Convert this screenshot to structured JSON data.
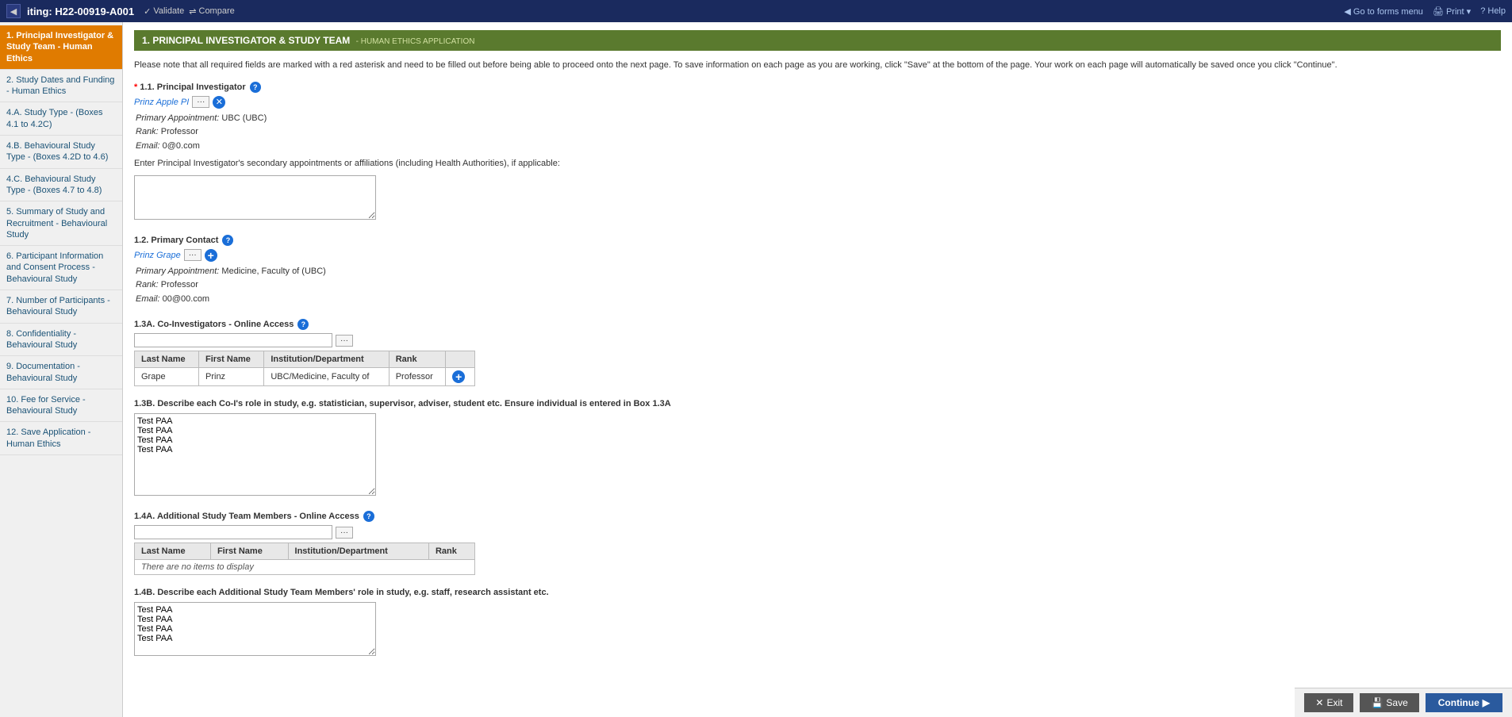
{
  "topbar": {
    "title": "iting: H22-00919-A001",
    "validate_label": "Validate",
    "compare_label": "Compare",
    "go_to_forms_label": "Go to forms menu",
    "print_label": "Print",
    "help_label": "Help"
  },
  "sidebar": {
    "items": [
      {
        "id": "item1",
        "label": "1. Principal Investigator & Study Team - Human Ethics",
        "active": true
      },
      {
        "id": "item2",
        "label": "2. Study Dates and Funding - Human Ethics",
        "active": false
      },
      {
        "id": "item3",
        "label": "4.A. Study Type - (Boxes 4.1 to 4.2C)",
        "active": false
      },
      {
        "id": "item4",
        "label": "4.B. Behavioural Study Type - (Boxes 4.2D to 4.6)",
        "active": false
      },
      {
        "id": "item5",
        "label": "4.C. Behavioural Study Type - (Boxes 4.7 to 4.8)",
        "active": false
      },
      {
        "id": "item6",
        "label": "5. Summary of Study and Recruitment - Behavioural Study",
        "active": false
      },
      {
        "id": "item7",
        "label": "6. Participant Information and Consent Process - Behavioural Study",
        "active": false
      },
      {
        "id": "item8",
        "label": "7. Number of Participants - Behavioural Study",
        "active": false
      },
      {
        "id": "item9",
        "label": "8. Confidentiality - Behavioural Study",
        "active": false
      },
      {
        "id": "item10",
        "label": "9. Documentation - Behavioural Study",
        "active": false
      },
      {
        "id": "item11",
        "label": "10. Fee for Service - Behavioural Study",
        "active": false
      },
      {
        "id": "item12",
        "label": "12. Save Application - Human Ethics",
        "active": false
      }
    ]
  },
  "section_header": {
    "main_label": "1. PRINCIPAL INVESTIGATOR & STUDY TEAM",
    "sub_label": "HUMAN ETHICS APPLICATION"
  },
  "instructions": "Please note that all required fields are marked with a red asterisk and need to be filled out before being able to proceed onto the next page. To save information on each page as you are working, click \"Save\" at the bottom of the page. Your work on each page will automatically be saved once you click \"Continue\".",
  "fields": {
    "principal_investigator": {
      "label": "1.1. Principal Investigator",
      "name": "Prinz Apple PI",
      "primary_appointment": "UBC (UBC)",
      "rank": "Professor",
      "email": "0@0.com",
      "secondary_label": "Enter Principal Investigator's secondary appointments or affiliations (including Health Authorities), if applicable:"
    },
    "primary_contact": {
      "label": "1.2. Primary Contact",
      "name": "Prinz Grape",
      "primary_appointment": "Medicine, Faculty of (UBC)",
      "rank": "Professor",
      "email": "00@00.com"
    },
    "co_investigators": {
      "label": "1.3A. Co-Investigators - Online Access",
      "columns": [
        "Last Name",
        "First Name",
        "Institution/Department",
        "Rank"
      ],
      "rows": [
        {
          "last_name": "Grape",
          "first_name": "Prinz",
          "institution": "UBC/Medicine, Faculty of",
          "rank": "Professor"
        }
      ]
    },
    "co_investigators_role": {
      "label": "1.3B. Describe each Co-I's role in study, e.g. statistician, supervisor, adviser, student etc. Ensure individual is entered in Box 1.3A",
      "value": "Test PAA\nTest PAA\nTest PAA\nTest PAA"
    },
    "additional_team": {
      "label": "1.4A. Additional Study Team Members - Online Access",
      "columns": [
        "Last Name",
        "First Name",
        "Institution/Department",
        "Rank"
      ],
      "rows": [],
      "no_items_label": "There are no items to display"
    },
    "additional_team_role": {
      "label": "1.4B. Describe each Additional Study Team Members' role in study, e.g. staff, research assistant etc.",
      "value": "Test PAA\nTest PAA\nTest PAA\nTest PAA"
    }
  },
  "bottom": {
    "exit_label": "Exit",
    "save_label": "Save",
    "continue_label": "Continue"
  }
}
